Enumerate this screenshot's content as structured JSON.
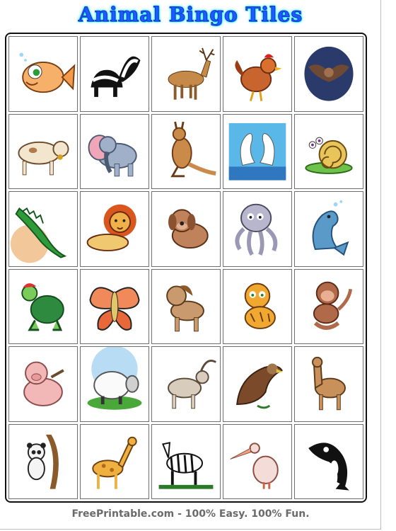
{
  "title": "Animal Bingo Tiles",
  "footer": "FreePrintable.com - 100% Easy. 100% Fun.",
  "colors": {
    "title": "#1e5bff",
    "title_glow": "#00f0ff",
    "footer": "#6a6a6a",
    "grid_line": "#111111"
  },
  "tiles": [
    {
      "animal": "fish",
      "icon": "fish-icon"
    },
    {
      "animal": "skunk",
      "icon": "skunk-icon"
    },
    {
      "animal": "deer",
      "icon": "deer-icon"
    },
    {
      "animal": "rooster",
      "icon": "rooster-icon"
    },
    {
      "animal": "bat",
      "icon": "bat-icon"
    },
    {
      "animal": "cow",
      "icon": "cow-icon"
    },
    {
      "animal": "elephant",
      "icon": "elephant-icon"
    },
    {
      "animal": "kangaroo",
      "icon": "kangaroo-icon"
    },
    {
      "animal": "swans",
      "icon": "swan-icon"
    },
    {
      "animal": "snail",
      "icon": "snail-icon"
    },
    {
      "animal": "alligator",
      "icon": "alligator-icon"
    },
    {
      "animal": "lion",
      "icon": "lion-icon"
    },
    {
      "animal": "dog",
      "icon": "dog-icon"
    },
    {
      "animal": "octopus",
      "icon": "octopus-icon"
    },
    {
      "animal": "dolphin",
      "icon": "dolphin-icon"
    },
    {
      "animal": "turtle",
      "icon": "turtle-icon"
    },
    {
      "animal": "butterfly",
      "icon": "butterfly-icon"
    },
    {
      "animal": "horse",
      "icon": "horse-icon"
    },
    {
      "animal": "tiger",
      "icon": "tiger-icon"
    },
    {
      "animal": "monkey",
      "icon": "monkey-icon"
    },
    {
      "animal": "pig",
      "icon": "pig-icon"
    },
    {
      "animal": "sheep",
      "icon": "sheep-icon"
    },
    {
      "animal": "goat",
      "icon": "goat-icon"
    },
    {
      "animal": "eagle",
      "icon": "eagle-icon"
    },
    {
      "animal": "llama",
      "icon": "llama-icon"
    },
    {
      "animal": "panda",
      "icon": "panda-icon"
    },
    {
      "animal": "giraffe",
      "icon": "giraffe-icon"
    },
    {
      "animal": "zebra",
      "icon": "zebra-icon"
    },
    {
      "animal": "pelican",
      "icon": "pelican-icon"
    },
    {
      "animal": "orca",
      "icon": "orca-icon"
    }
  ]
}
